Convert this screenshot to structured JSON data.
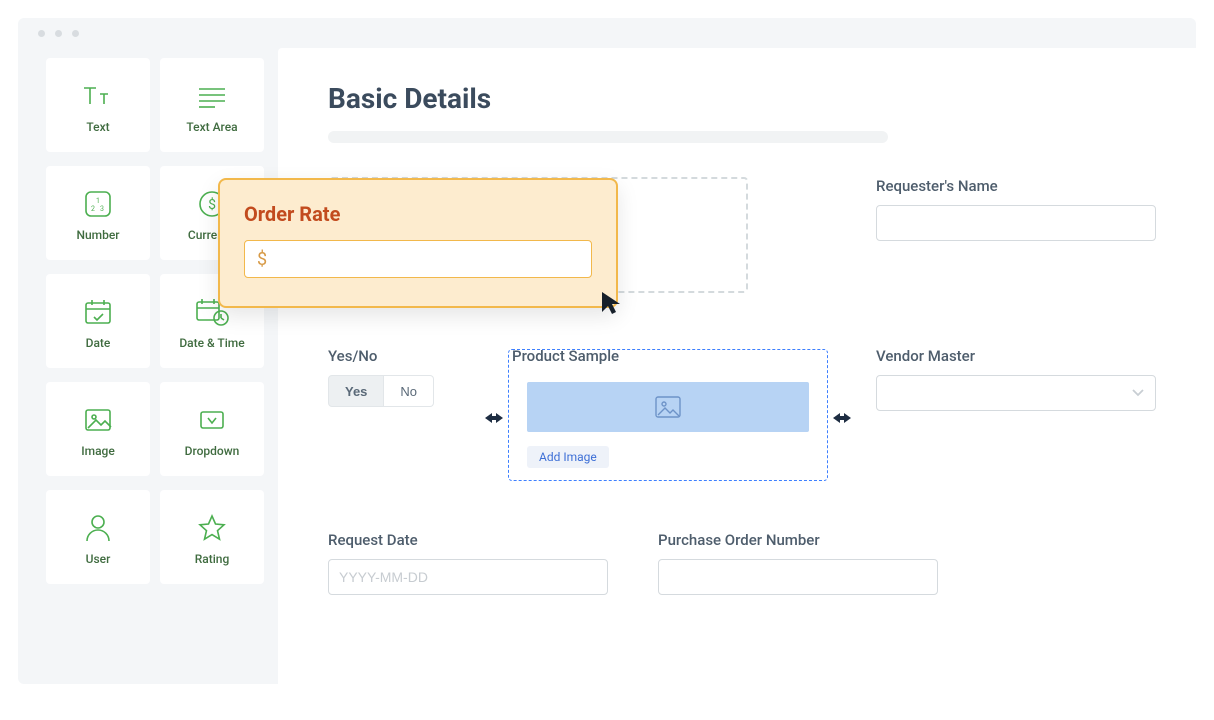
{
  "palette": [
    {
      "label": "Text",
      "name": "text"
    },
    {
      "label": "Text Area",
      "name": "textarea"
    },
    {
      "label": "Number",
      "name": "number"
    },
    {
      "label": "Currency",
      "name": "currency"
    },
    {
      "label": "Date",
      "name": "date"
    },
    {
      "label": "Date & Time",
      "name": "datetime"
    },
    {
      "label": "Image",
      "name": "image"
    },
    {
      "label": "Dropdown",
      "name": "dropdown"
    },
    {
      "label": "User",
      "name": "user"
    },
    {
      "label": "Rating",
      "name": "rating"
    }
  ],
  "page": {
    "title": "Basic Details"
  },
  "drag": {
    "title": "Order Rate",
    "prefix": "$"
  },
  "fields": {
    "requester": {
      "label": "Requester's Name",
      "value": ""
    },
    "yesno": {
      "label": "Yes/No",
      "yes": "Yes",
      "no": "No",
      "active": "yes"
    },
    "sample": {
      "label": "Product Sample",
      "add": "Add Image"
    },
    "vendor": {
      "label": "Vendor Master",
      "value": ""
    },
    "reqdate": {
      "label": "Request Date",
      "placeholder": "YYYY-MM-DD",
      "value": ""
    },
    "ponum": {
      "label": "Purchase Order Number",
      "value": ""
    }
  }
}
